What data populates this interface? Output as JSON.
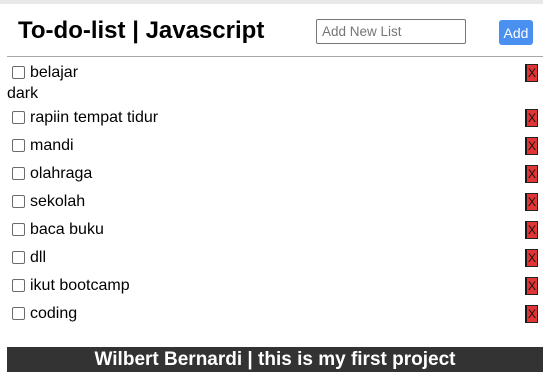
{
  "header": {
    "title": "To-do-list | Javascript",
    "input_placeholder": "Add New List",
    "input_value": "",
    "add_label": "Add"
  },
  "todos": [
    {
      "label": "belajar",
      "checked": false,
      "delete_label": "X"
    },
    {
      "label": "rapiin tempat tidur",
      "checked": false,
      "delete_label": "X"
    },
    {
      "label": "mandi",
      "checked": false,
      "delete_label": "X"
    },
    {
      "label": "olahraga",
      "checked": false,
      "delete_label": "X"
    },
    {
      "label": "sekolah",
      "checked": false,
      "delete_label": "X"
    },
    {
      "label": "baca buku",
      "checked": false,
      "delete_label": "X"
    },
    {
      "label": "dll",
      "checked": false,
      "delete_label": "X"
    },
    {
      "label": "ikut bootcamp",
      "checked": false,
      "delete_label": "X"
    },
    {
      "label": "coding",
      "checked": false,
      "delete_label": "X"
    }
  ],
  "dark_toggle": {
    "label": "dark"
  },
  "footer": {
    "text": "Wilbert Bernardi | this is my first project"
  },
  "colors": {
    "add_button": "#4a90f0",
    "delete_button": "#e23434",
    "footer_bg": "#333333"
  }
}
